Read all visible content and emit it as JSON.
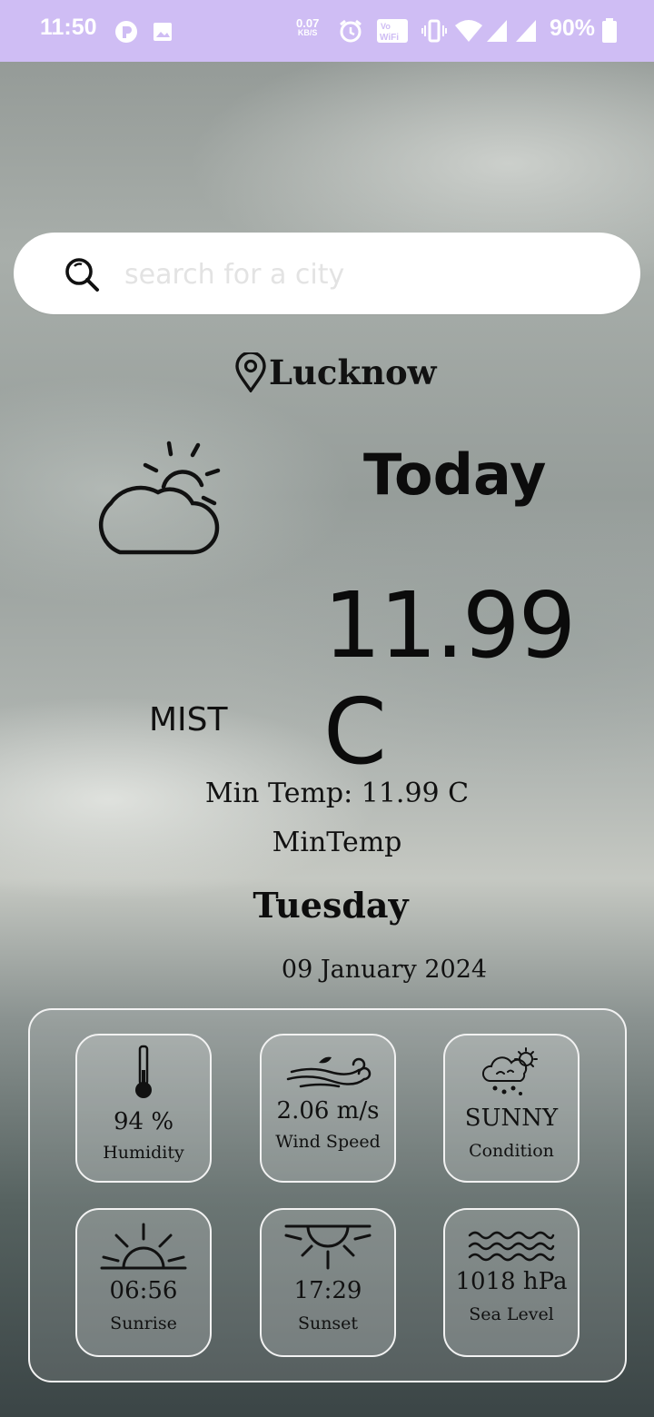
{
  "status_bar": {
    "time": "11:50",
    "net_speed_value": "0.07",
    "net_speed_unit": "KB/S",
    "battery": "90%",
    "background_color": "#cfbdf4"
  },
  "search": {
    "placeholder": "search for a city",
    "value": ""
  },
  "location": {
    "city": "Lucknow"
  },
  "weather": {
    "day_label": "Today",
    "temperature": "11.99 C",
    "condition": "MIST",
    "min_temp_text": "Min Temp: 11.99 C",
    "min_temp_label": "MinTemp",
    "weekday": "Tuesday",
    "date": "09 January 2024"
  },
  "details": {
    "humidity": {
      "value": "94 %",
      "label": "Humidity",
      "icon": "thermometer-icon"
    },
    "wind": {
      "value": "2.06 m/s",
      "label": "Wind Speed",
      "icon": "wind-icon"
    },
    "condition": {
      "value": "SUNNY",
      "label": "Condition",
      "icon": "cloud-sun-rain-icon"
    },
    "sunrise": {
      "value": "06:56",
      "label": "Sunrise",
      "icon": "sunrise-icon"
    },
    "sunset": {
      "value": "17:29",
      "label": "Sunset",
      "icon": "sunset-icon"
    },
    "sea_level": {
      "value": "1018 hPa",
      "label": "Sea Level",
      "icon": "waves-icon"
    }
  }
}
